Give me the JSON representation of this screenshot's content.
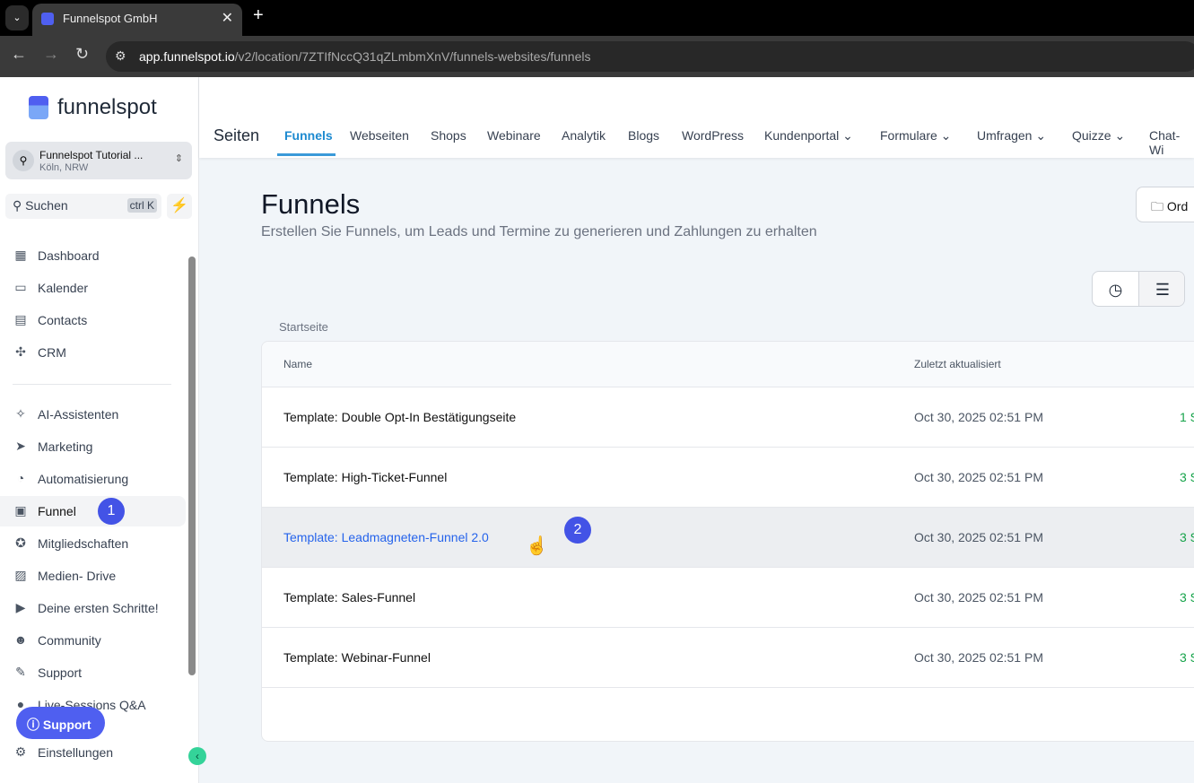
{
  "browser": {
    "tab_title": "Funnelspot GmbH",
    "url_host": "app.funnelspot.io",
    "url_path": "/v2/location/7ZTIfNccQ31qZLmbmXnV/funnels-websites/funnels"
  },
  "sidebar": {
    "logo": "funnelspot",
    "account_name": "Funnelspot Tutorial ...",
    "account_location": "Köln, NRW",
    "search_label": "Suchen",
    "search_shortcut": "ctrl K",
    "items": [
      {
        "label": "Dashboard",
        "icon": "▦"
      },
      {
        "label": "Kalender",
        "icon": "▭"
      },
      {
        "label": "Contacts",
        "icon": "▤"
      },
      {
        "label": "CRM",
        "icon": "✣"
      }
    ],
    "items2": [
      {
        "label": "AI-Assistenten",
        "icon": "✧"
      },
      {
        "label": "Marketing",
        "icon": "➤"
      },
      {
        "label": "Automatisierung",
        "icon": "◔"
      },
      {
        "label": "Funnel",
        "icon": "▣"
      },
      {
        "label": "Mitgliedschaften",
        "icon": "✪"
      },
      {
        "label": "Medien- Drive",
        "icon": "▨"
      },
      {
        "label": "Deine ersten Schritte!",
        "icon": "▶"
      },
      {
        "label": "Community",
        "icon": "☻"
      },
      {
        "label": "Support",
        "icon": "✎"
      },
      {
        "label": "Live-Sessions Q&A",
        "icon": "●"
      }
    ],
    "settings": "Einstellungen",
    "support_button": "Support",
    "badge1": "1"
  },
  "topnav": {
    "section": "Seiten",
    "tabs": [
      "Funnels",
      "Webseiten",
      "Shops",
      "Webinare",
      "Analytik",
      "Blogs",
      "WordPress",
      "Kundenportal ⌄",
      "Formulare ⌄",
      "Umfragen ⌄",
      "Quizze ⌄",
      "Chat-Wi"
    ]
  },
  "main": {
    "title": "Funnels",
    "subtitle": "Erstellen Sie Funnels, um Leads und Termine zu generieren und Zahlungen zu erhalten",
    "folder_button": "Ord",
    "breadcrumb": "Startseite",
    "badge2": "2",
    "columns": {
      "name": "Name",
      "updated": "Zuletzt aktualisiert"
    },
    "rows": [
      {
        "name": "Template: Double Opt-In Bestätigungseite",
        "updated": "Oct 30, 2025 02:51 PM",
        "steps": "1 S"
      },
      {
        "name": "Template: High-Ticket-Funnel",
        "updated": "Oct 30, 2025 02:51 PM",
        "steps": "3 S"
      },
      {
        "name": "Template: Leadmagneten-Funnel 2.0",
        "updated": "Oct 30, 2025 02:51 PM",
        "steps": "3 S"
      },
      {
        "name": "Template: Sales-Funnel",
        "updated": "Oct 30, 2025 02:51 PM",
        "steps": "3 S"
      },
      {
        "name": "Template: Webinar-Funnel",
        "updated": "Oct 30, 2025 02:51 PM",
        "steps": "3 S"
      }
    ]
  }
}
